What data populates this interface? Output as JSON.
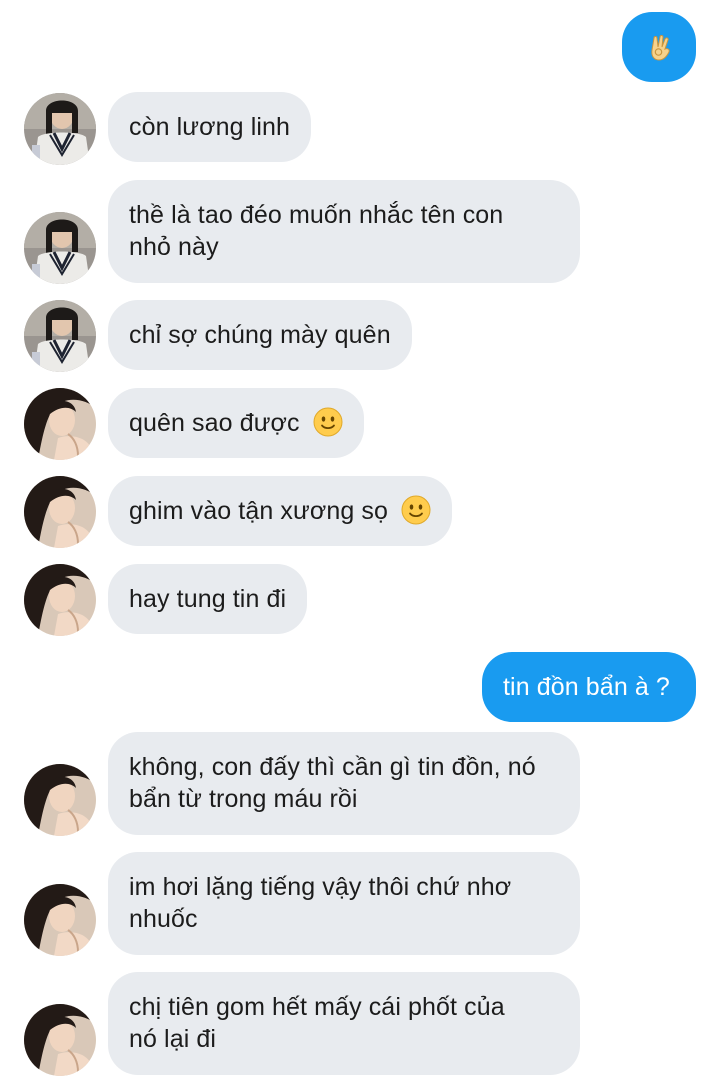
{
  "conversation": {
    "sent_top": {
      "icon": "ok-hand-emoji"
    },
    "messages": [
      {
        "id": "m1",
        "text": "còn lương linh",
        "emoji": ""
      },
      {
        "id": "m2",
        "line1": "thề là tao đéo muốn nhắc tên con",
        "line2": "nhỏ này"
      },
      {
        "id": "m3",
        "text": "chỉ sợ chúng mày quên",
        "emoji": ""
      },
      {
        "id": "m4",
        "text": "quên sao được",
        "emoji": "slightly-smiling-face"
      },
      {
        "id": "m5",
        "text": "ghim vào tận xương sọ",
        "emoji": "slightly-smiling-face"
      },
      {
        "id": "m6",
        "text": "hay tung tin đi",
        "emoji": ""
      },
      {
        "id": "m7",
        "text": "tin đồn bẩn à ?"
      },
      {
        "id": "m8",
        "line1": "không, con đấy thì cần gì tin đồn, nó",
        "line2": "bẩn từ trong máu rồi"
      },
      {
        "id": "m9",
        "line1": "im hơi lặng tiếng vậy thôi chứ nhơ",
        "line2": "nhuốc"
      },
      {
        "id": "m10",
        "line1": "chị tiên gom hết mấy cái phốt của",
        "line2": "nó lại đi"
      }
    ]
  },
  "colors": {
    "incoming_bubble": "#e8ebef",
    "outgoing_bubble": "#199bf0",
    "incoming_text": "#1c1c1c",
    "outgoing_text": "#ffffff"
  }
}
